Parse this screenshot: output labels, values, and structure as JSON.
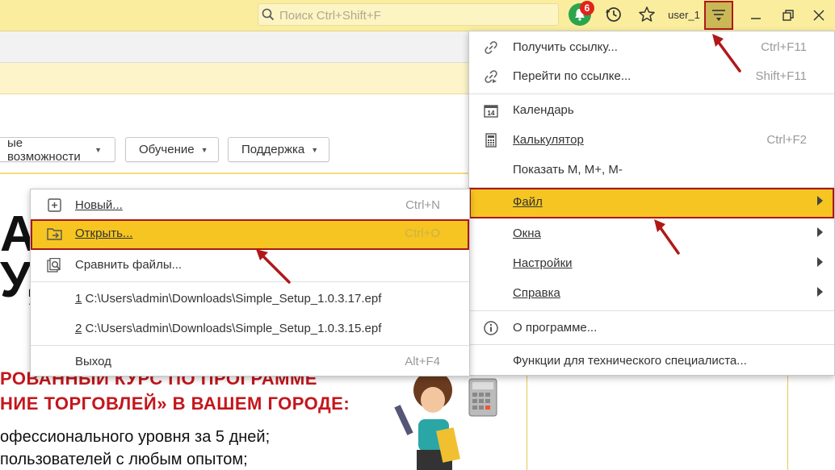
{
  "search": {
    "placeholder": "Поиск Ctrl+Shift+F"
  },
  "header": {
    "notifications_count": "6",
    "username": "user_1"
  },
  "toolbar": [
    {
      "label": "ые возможности"
    },
    {
      "label": "Обучение"
    },
    {
      "label": "Поддержка"
    }
  ],
  "banner": {
    "big_line1": "АТ",
    "big_line2": "У,",
    "red_line1": "РОВАННЫЙ КУРС ПО ПРОГРАММЕ",
    "red_line2": "НИЕ ТОРГОВЛЕЙ» В ВАШЕМ ГОРОДЕ:",
    "text_line1": "офессионального уровня за 5 дней;",
    "text_line2": "пользователей с любым опытом;"
  },
  "main_menu": {
    "get_link": {
      "label": "Получить ссылку...",
      "shortcut": "Ctrl+F11"
    },
    "follow_link": {
      "label": "Перейти по ссылке...",
      "shortcut": "Shift+F11"
    },
    "calendar": {
      "label": "Календарь",
      "icon_text": "14"
    },
    "calculator": {
      "label": "Калькулятор",
      "shortcut": "Ctrl+F2"
    },
    "show_m": {
      "label": "Показать M, M+, M-"
    },
    "file": {
      "label": "Файл"
    },
    "windows": {
      "label": "Окна"
    },
    "settings": {
      "label": "Настройки"
    },
    "help": {
      "label": "Справка"
    },
    "about": {
      "label": "О программе..."
    },
    "tech": {
      "label": "Функции для технического специалиста..."
    }
  },
  "file_menu": {
    "new": {
      "label": "Новый...",
      "shortcut": "Ctrl+N"
    },
    "open": {
      "label": "Открыть...",
      "shortcut": "Ctrl+O"
    },
    "compare": {
      "label": "Сравнить файлы..."
    },
    "recent": [
      {
        "num": "1",
        "path": " C:\\Users\\admin\\Downloads\\Simple_Setup_1.0.3.17.epf"
      },
      {
        "num": "2",
        "path": " C:\\Users\\admin\\Downloads\\Simple_Setup_1.0.3.15.epf"
      }
    ],
    "exit": {
      "label": "Выход",
      "shortcut": "Alt+F4"
    }
  },
  "colors": {
    "accent": "#f6c521",
    "highlight_border": "#a8181b",
    "topbar": "#fbed9e",
    "badge": "#e2231a"
  }
}
